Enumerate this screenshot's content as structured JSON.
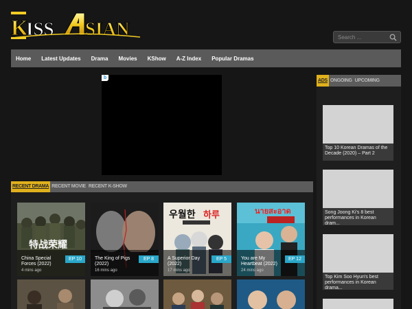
{
  "header": {
    "logo_text": "KISSASIAN",
    "search_placeholder": "Search ..."
  },
  "nav": {
    "items": [
      "Home",
      "Latest Updates",
      "Drama",
      "Movies",
      "KShow",
      "A-Z Index",
      "Popular Dramas"
    ]
  },
  "main": {
    "tabs": [
      "RECENT DRAMA",
      "RECENT MOVIE",
      "RECENT K-SHOW"
    ],
    "active_tab": "RECENT DRAMA",
    "cards": [
      {
        "title": "China Special Forces (2022)",
        "time": "4 mins ago",
        "episode": "EP 10"
      },
      {
        "title": "The King of Pigs (2022)",
        "time": "16 mins ago",
        "episode": "EP 8"
      },
      {
        "title": "A Superior Day (2022)",
        "time": "17 mins ago",
        "episode": "EP 5"
      },
      {
        "title": "You are My Heartbeat (2022)",
        "time": "24 mins ago",
        "episode": "EP 12"
      }
    ]
  },
  "sidebar": {
    "tabs": [
      "ADS",
      "ONGOING",
      "UPCOMING"
    ],
    "active_tab": "ADS",
    "items": [
      {
        "caption": "Top 10 Korean Dramas of the Decade (2020) – Part 2"
      },
      {
        "caption": "Song Joong Ki's 8 best performances in Korean dram..."
      },
      {
        "caption": "Top Kim Soo Hyun's best performances in Korean drama..."
      }
    ]
  },
  "colors": {
    "accent": "#e0b11d",
    "episode_badge": "#2aa7c9",
    "nav_bg": "#5a5a5a",
    "page_bg": "#161616"
  },
  "icons": {
    "search": "search-icon"
  }
}
